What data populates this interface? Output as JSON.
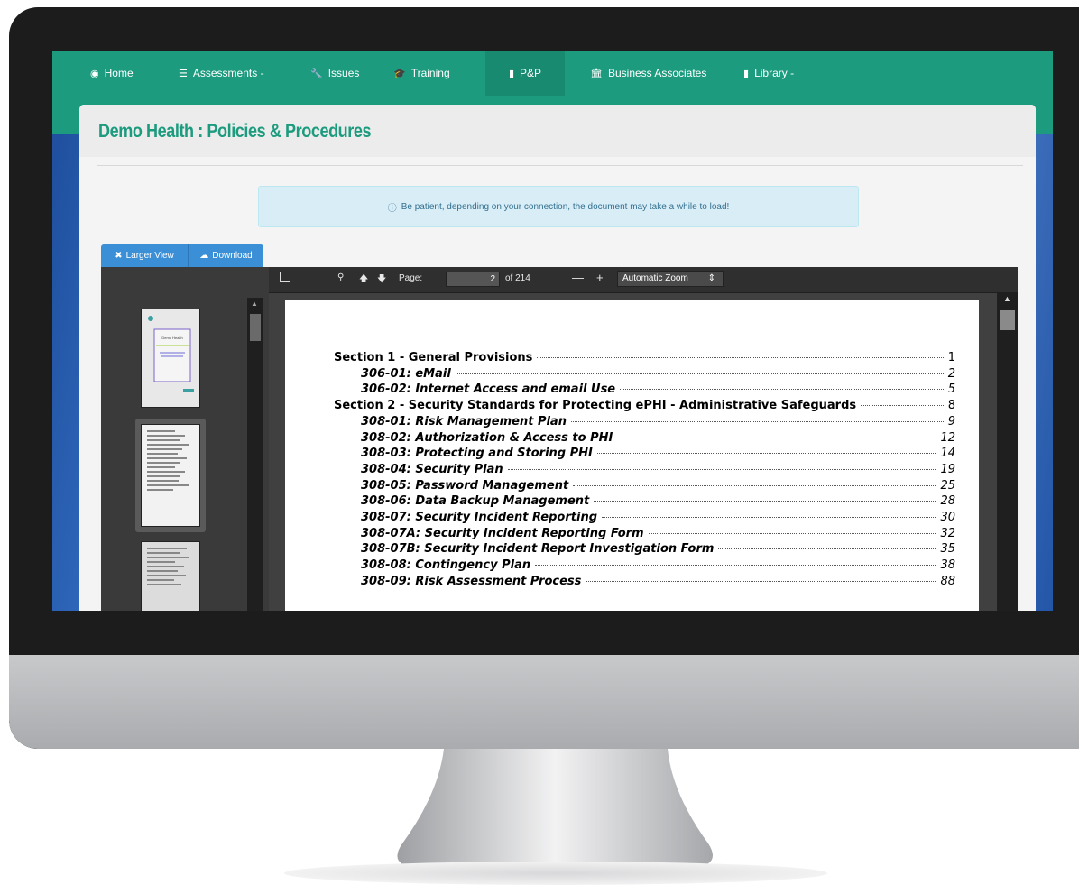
{
  "nav": {
    "items": [
      {
        "icon": "dashboard-icon",
        "label": "Home"
      },
      {
        "icon": "list-icon",
        "label": "Assessments -"
      },
      {
        "icon": "wrench-icon",
        "label": "Issues"
      },
      {
        "icon": "graduation-cap-icon",
        "label": "Training"
      },
      {
        "icon": "book-icon",
        "label": "P&P"
      },
      {
        "icon": "bank-icon",
        "label": "Business Associates"
      },
      {
        "icon": "book-icon",
        "label": "Library -"
      }
    ],
    "active": "P&P"
  },
  "page": {
    "title": "Demo Health : Policies & Procedures"
  },
  "alert": {
    "icon": "info-icon",
    "text": "Be patient, depending on your connection, the document may take a while to load!"
  },
  "buttons": {
    "larger_view": "Larger View",
    "download": "Download"
  },
  "viewer": {
    "page_label": "Page:",
    "page_value": "2",
    "page_total": "of 214",
    "zoom": "Automatic Zoom"
  },
  "thumbnail": {
    "title": "Demo Health"
  },
  "toc": [
    {
      "label": "Section 1 - General Provisions",
      "page": "1",
      "level": 0
    },
    {
      "label": "306-01: eMail",
      "page": "2",
      "level": 1
    },
    {
      "label": "306-02: Internet Access and email Use",
      "page": "5",
      "level": 1
    },
    {
      "label": "Section 2 - Security Standards for Protecting ePHI - Administrative Safeguards",
      "page": "8",
      "level": 0
    },
    {
      "label": "308-01: Risk Management Plan",
      "page": "9",
      "level": 1
    },
    {
      "label": "308-02: Authorization & Access to PHI",
      "page": "12",
      "level": 1
    },
    {
      "label": "308-03: Protecting and Storing PHI",
      "page": "14",
      "level": 1
    },
    {
      "label": "308-04: Security Plan",
      "page": "19",
      "level": 1
    },
    {
      "label": "308-05: Password Management",
      "page": "25",
      "level": 1
    },
    {
      "label": "308-06: Data Backup Management",
      "page": "28",
      "level": 1
    },
    {
      "label": "308-07: Security Incident Reporting",
      "page": "30",
      "level": 1
    },
    {
      "label": "308-07A: Security Incident Reporting Form",
      "page": "32",
      "level": 1
    },
    {
      "label": "308-07B: Security Incident Report Investigation Form",
      "page": "35",
      "level": 1
    },
    {
      "label": "308-08: Contingency Plan",
      "page": "38",
      "level": 1
    },
    {
      "label": "308-09: Risk Assessment Process",
      "page": "88",
      "level": 1
    }
  ],
  "colors": {
    "brand": "#1d9b7e",
    "alert_bg": "#d9edf7",
    "button": "#3a8fd6"
  }
}
